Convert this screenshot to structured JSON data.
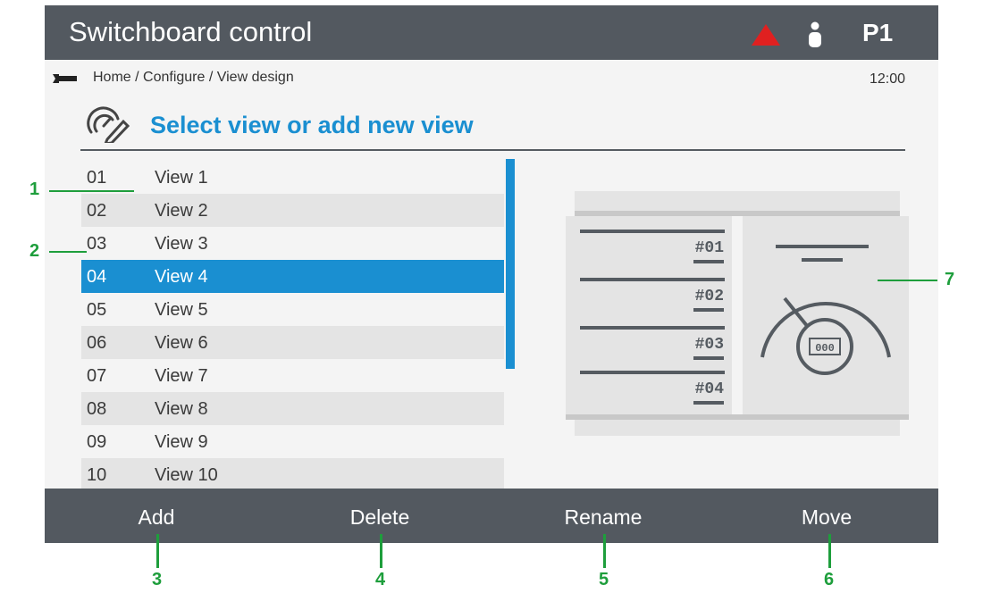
{
  "header": {
    "title": "Switchboard control",
    "profile": "P1",
    "icons": [
      "alarm-triangle-icon",
      "user-icon"
    ],
    "alarm_color": "#e02020"
  },
  "breadcrumb": "Home / Configure / View design",
  "clock": "12:00",
  "page_title": "Select view or add new view",
  "views": [
    {
      "num": "01",
      "label": "View 1"
    },
    {
      "num": "02",
      "label": "View 2"
    },
    {
      "num": "03",
      "label": "View 3"
    },
    {
      "num": "04",
      "label": "View 4"
    },
    {
      "num": "05",
      "label": "View 5"
    },
    {
      "num": "06",
      "label": "View 6"
    },
    {
      "num": "07",
      "label": "View 7"
    },
    {
      "num": "08",
      "label": "View 8"
    },
    {
      "num": "09",
      "label": "View 9"
    },
    {
      "num": "10",
      "label": "View 10"
    }
  ],
  "selected_index": 3,
  "preview": {
    "tags": [
      "#01",
      "#02",
      "#03",
      "#04"
    ],
    "gauge_display": "000"
  },
  "footer": {
    "add": "Add",
    "delete": "Delete",
    "rename": "Rename",
    "move": "Move"
  },
  "callouts": [
    "1",
    "2",
    "3",
    "4",
    "5",
    "6",
    "7"
  ],
  "colors": {
    "accent": "#1a8fd1",
    "bar": "#535960",
    "callout": "#1e9e3c"
  }
}
